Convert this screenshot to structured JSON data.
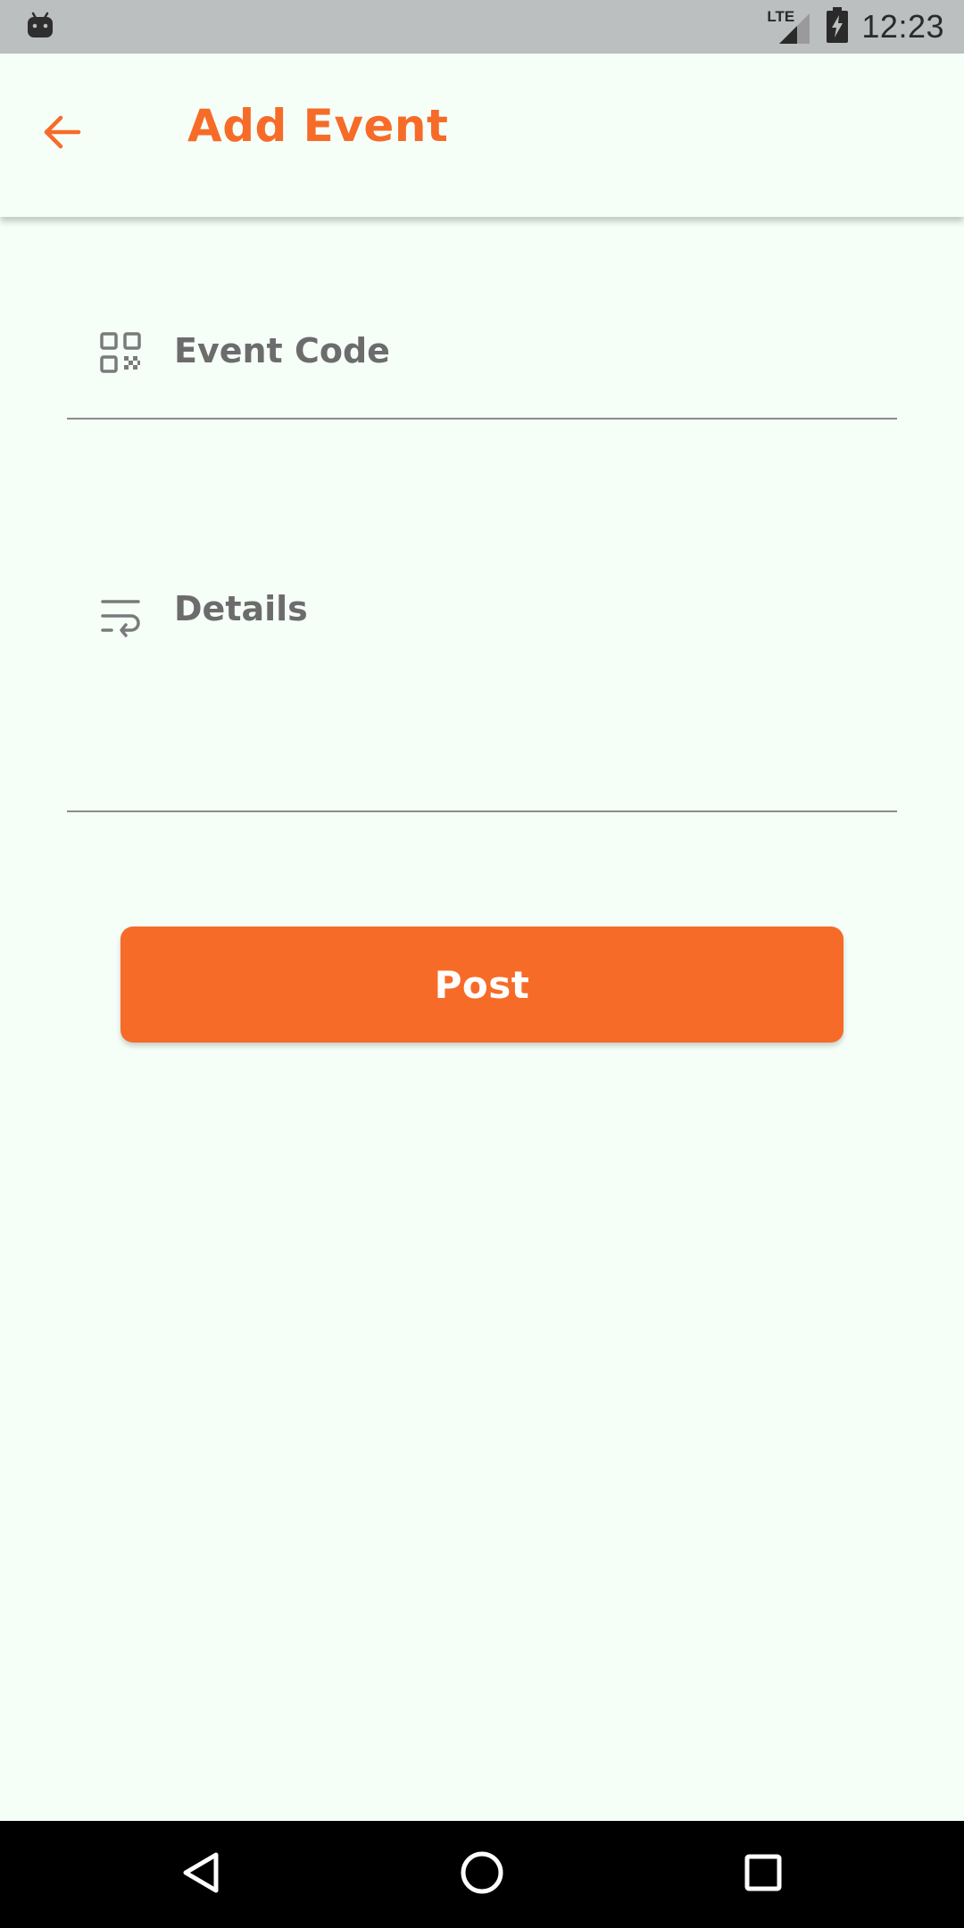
{
  "status_bar": {
    "time": "12:23",
    "network_label": "LTE",
    "icons": [
      "android-debug-icon",
      "signal-icon",
      "battery-charging-icon"
    ]
  },
  "app_bar": {
    "title": "Add Event",
    "back_icon": "arrow-back-icon"
  },
  "form": {
    "event_code": {
      "placeholder": "Event Code",
      "value": "",
      "icon": "qr-code-icon"
    },
    "details": {
      "placeholder": "Details",
      "value": "",
      "icon": "wrap-text-icon"
    }
  },
  "actions": {
    "post_label": "Post"
  },
  "nav_bar": {
    "icons": [
      "nav-back-icon",
      "nav-home-icon",
      "nav-recents-icon"
    ]
  },
  "colors": {
    "accent": "#f76b29",
    "background": "#f5fff8",
    "status_bar": "#bcbfbf",
    "nav_bar": "#000000",
    "field_text": "#6c6c6c"
  }
}
